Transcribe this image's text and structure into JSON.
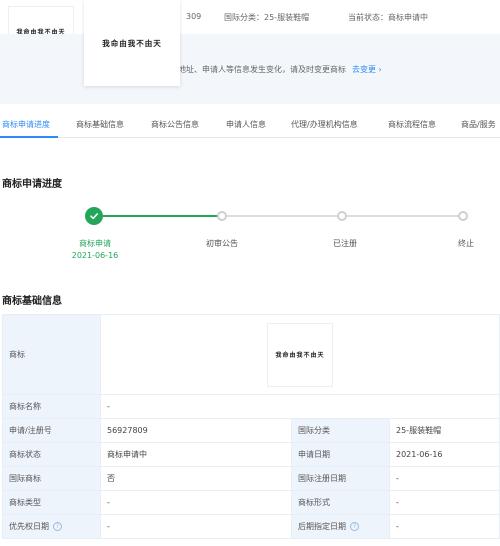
{
  "header": {
    "reg_number_fragment": "309",
    "intl_class": "国际分类：25-服装鞋帽",
    "current_status": "当前状态：商标申请中",
    "trademark_text": "我命由我不由天",
    "notice_text": "地址、申请人等信息发生变化，请及时变更商标",
    "notice_link": "去变更 ›"
  },
  "tabs": [
    {
      "label": "商标申请进度"
    },
    {
      "label": "商标基础信息"
    },
    {
      "label": "商标公告信息"
    },
    {
      "label": "申请人信息"
    },
    {
      "label": "代理/办理机构信息"
    },
    {
      "label": "商标流程信息"
    },
    {
      "label": "商品/服务"
    }
  ],
  "progress": {
    "title": "商标申请进度",
    "steps": [
      {
        "label": "商标申请",
        "date": "2021-06-16",
        "done": true
      },
      {
        "label": "初审公告"
      },
      {
        "label": "已注册"
      },
      {
        "label": "终止"
      }
    ]
  },
  "basic": {
    "title": "商标基础信息",
    "logo_label": "商标",
    "rows": [
      {
        "k1": "商标名称",
        "v1": "-"
      },
      {
        "k1": "申请/注册号",
        "v1": "56927809",
        "k2": "国际分类",
        "v2": "25-服装鞋帽"
      },
      {
        "k1": "商标状态",
        "v1": "商标申请中",
        "k2": "申请日期",
        "v2": "2021-06-16"
      },
      {
        "k1": "国际商标",
        "v1": "否",
        "k2": "国际注册日期",
        "v2": "-"
      },
      {
        "k1": "商标类型",
        "v1": "-",
        "k2": "商标形式",
        "v2": "-"
      },
      {
        "k1": "优先权日期",
        "v1": "-",
        "k2": "后期指定日期",
        "v2": "-"
      }
    ],
    "help_glyph": "?"
  },
  "colors": {
    "accent": "#2f8af5",
    "success": "#23a65a",
    "key_bg": "#eef4fb"
  }
}
